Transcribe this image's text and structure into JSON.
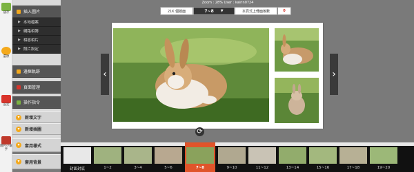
{
  "tools": [
    {
      "label": "儲存",
      "color": "#7cb342"
    },
    {
      "label": "還原",
      "color": "#f4a91c"
    },
    {
      "label": "設定",
      "color": "#d9342b"
    },
    {
      "label": "圖片小幫手",
      "color": "#c0392b"
    }
  ],
  "menu": {
    "header1": "插入圖片",
    "sub_items": [
      "本地檔案",
      "網路相簿",
      "相容相片",
      "照片設定"
    ],
    "header2": "邊框軌跡",
    "header3": "頁面管理",
    "header4": "操作指令",
    "buttons": [
      "新增文字",
      "新增插圖",
      "套用樣式",
      "套用背景"
    ]
  },
  "zoom_text": "Zoom : 28%   User : kairin0724",
  "top_controls": {
    "left_box": "21K 個版面",
    "page": "7~8",
    "right_box": "本頁式上傳面板數",
    "count": "0"
  },
  "filmstrip": {
    "labels": [
      "封面封底",
      "1~2",
      "3~4",
      "5~6",
      "7~8",
      "9~10",
      "11~12",
      "13~14",
      "15~16",
      "17~18",
      "19~20"
    ],
    "selected": "7~8"
  },
  "colors": {
    "accent": "#e0542a",
    "menu_bullet": "#f4a91c"
  }
}
